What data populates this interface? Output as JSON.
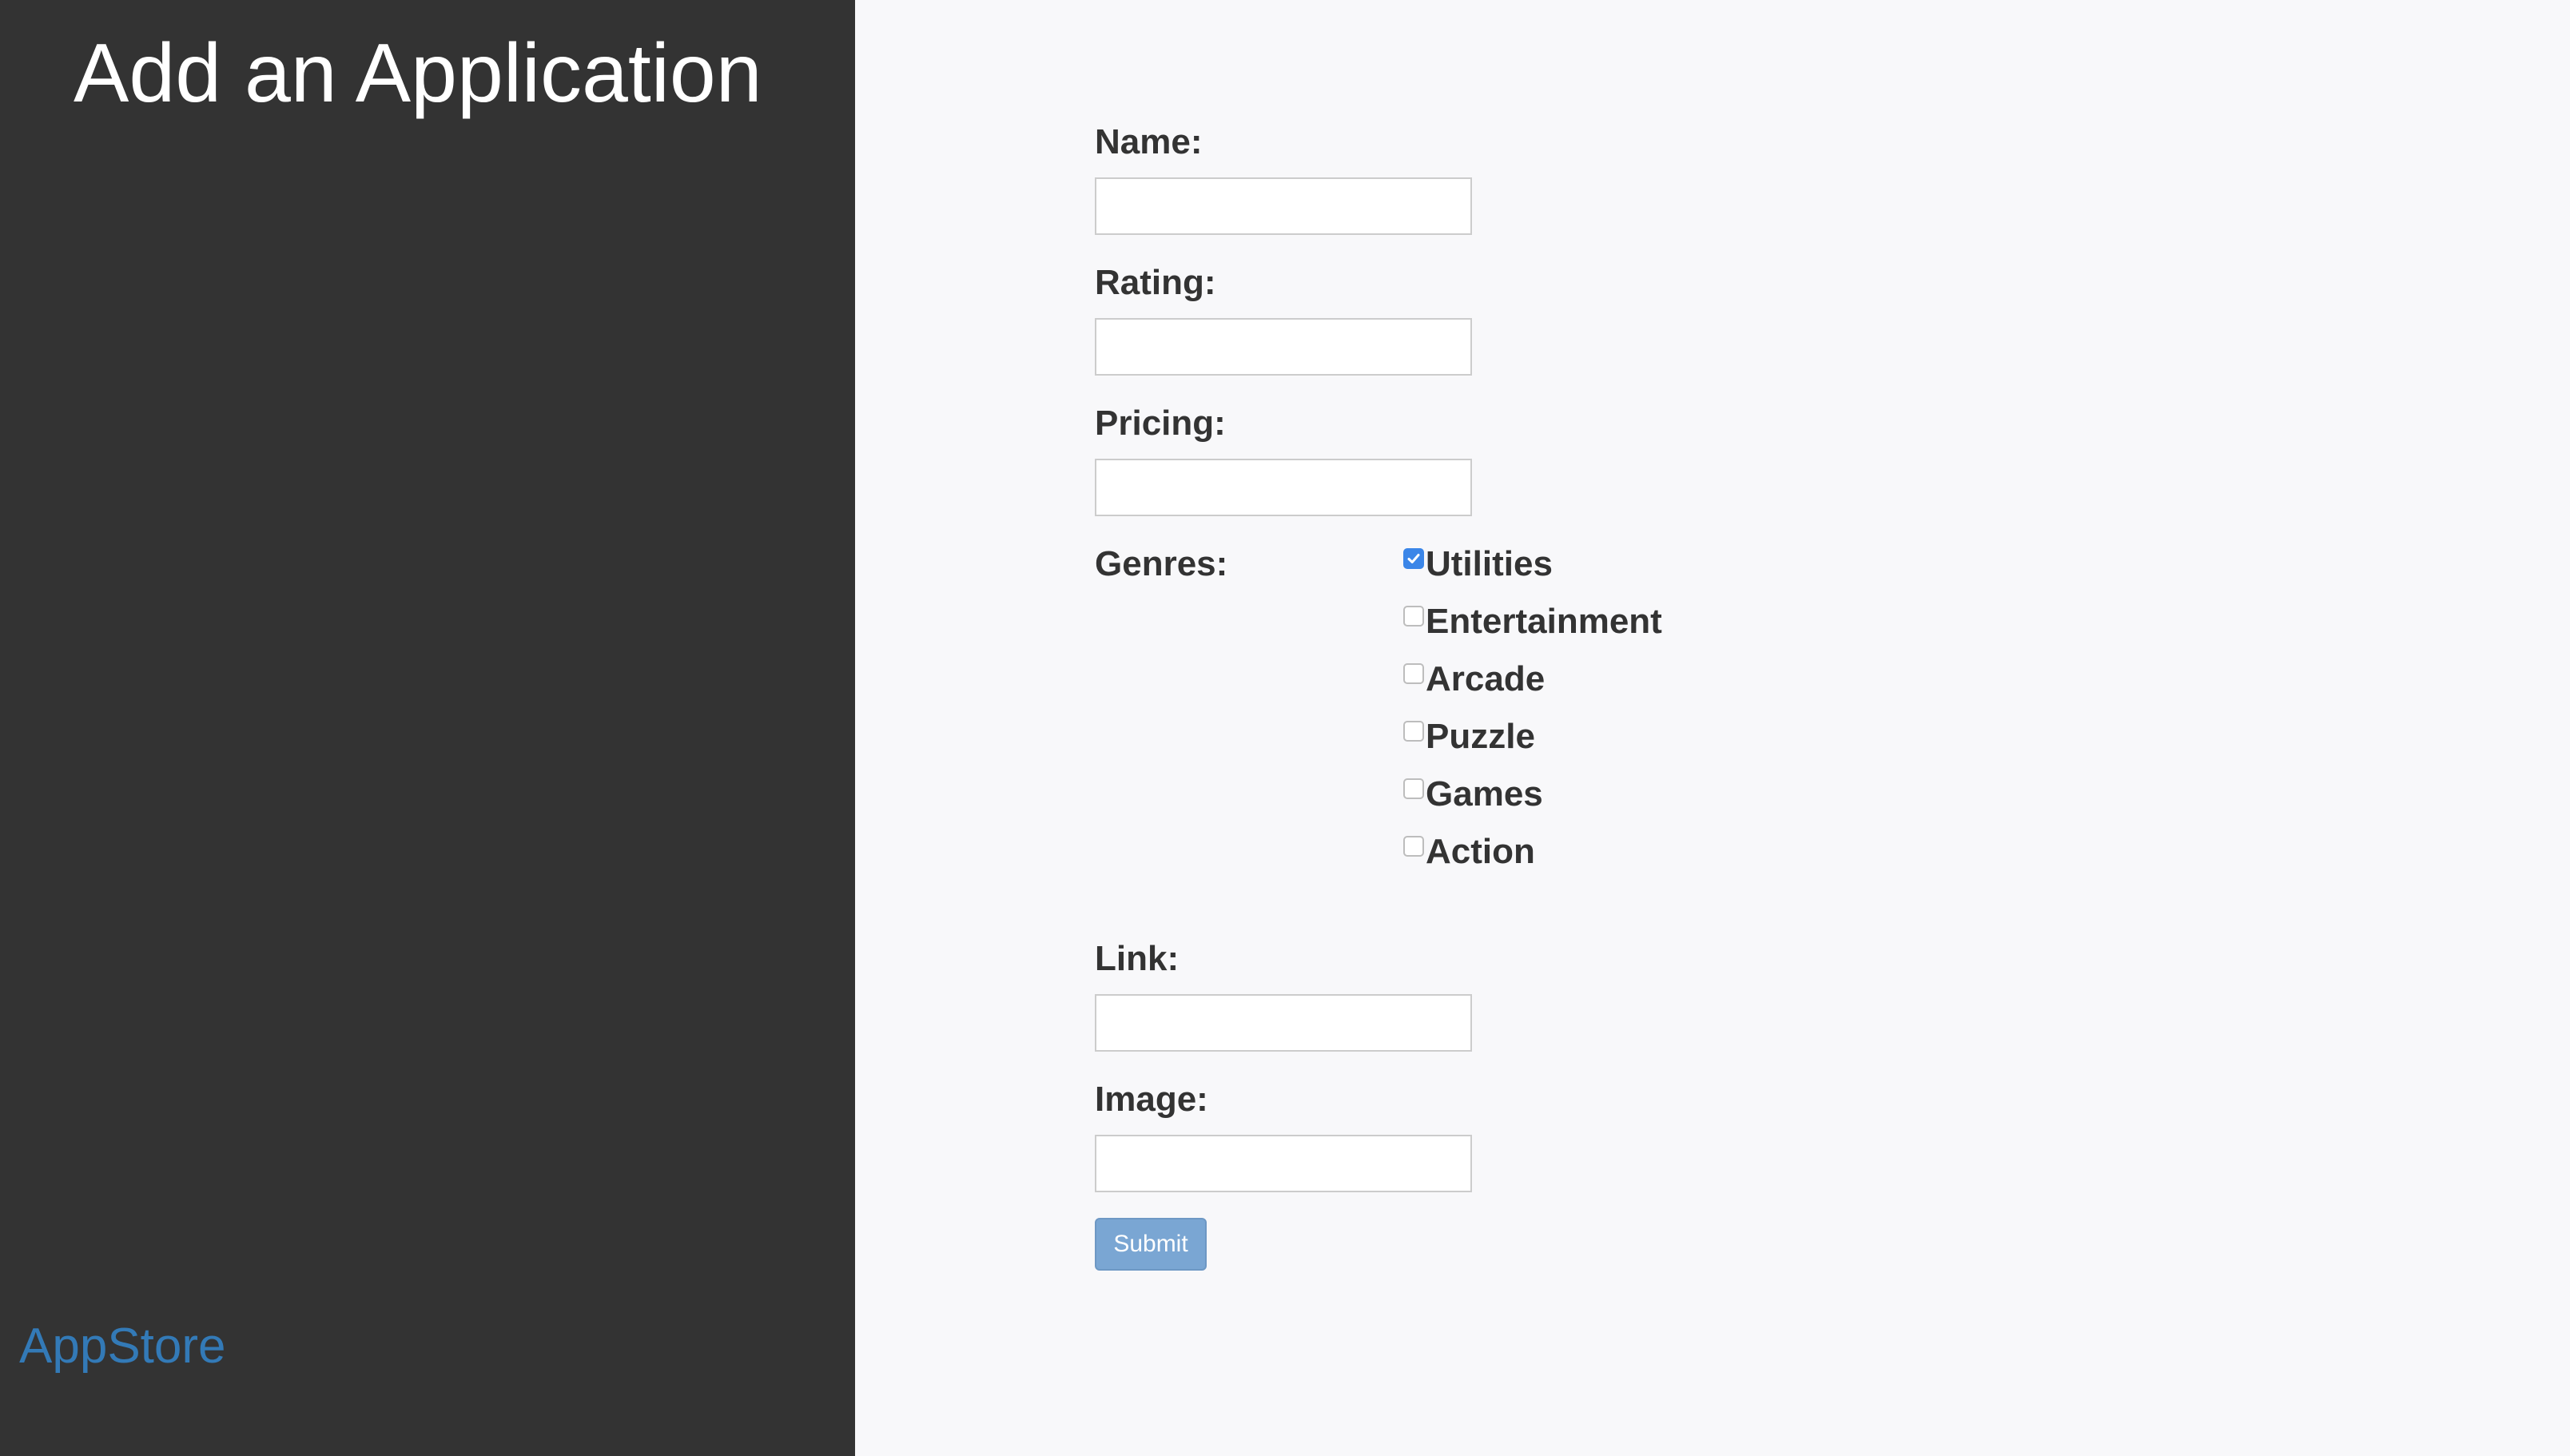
{
  "sidebar": {
    "title": "Add an Application",
    "brand": "AppStore"
  },
  "form": {
    "name_label": "Name:",
    "name_value": "",
    "rating_label": "Rating:",
    "rating_value": "",
    "pricing_label": "Pricing:",
    "pricing_value": "",
    "genres_label": "Genres:",
    "genres": [
      {
        "label": "Utilities",
        "checked": true
      },
      {
        "label": "Entertainment",
        "checked": false
      },
      {
        "label": "Arcade",
        "checked": false
      },
      {
        "label": "Puzzle",
        "checked": false
      },
      {
        "label": "Games",
        "checked": false
      },
      {
        "label": "Action",
        "checked": false
      }
    ],
    "link_label": "Link:",
    "link_value": "",
    "image_label": "Image:",
    "image_value": "",
    "submit_label": "Submit"
  },
  "colors": {
    "sidebar_bg": "#333333",
    "brand": "#337ab7",
    "checkbox_accent": "#3b86e8",
    "submit_bg": "#7aa6d3"
  }
}
